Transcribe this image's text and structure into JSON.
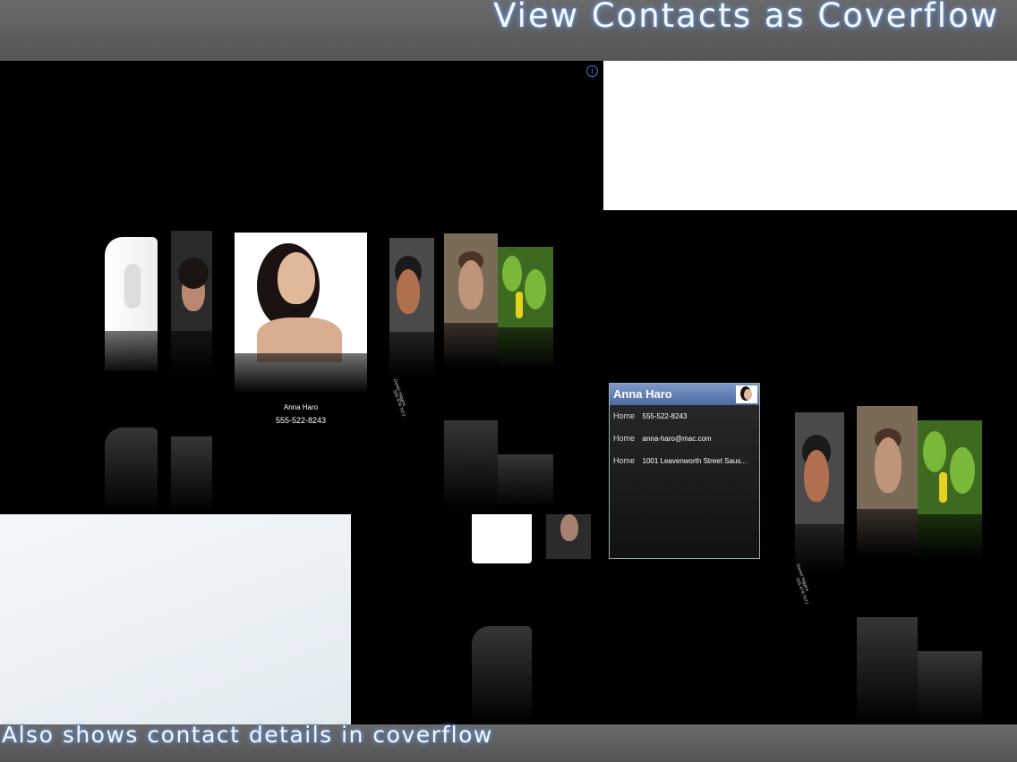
{
  "header": {
    "title": "View Contacts as Coverflow"
  },
  "footer": {
    "caption": "Also shows contact details in coverflow"
  },
  "coverflow": {
    "selected": {
      "name": "Anna Haro",
      "phone": "555-522-8243"
    },
    "side_label_name": "Daniel Higgins",
    "side_label_phone": "555-478-7672"
  },
  "detail_card": {
    "name": "Anna Haro",
    "rows": [
      {
        "label": "Home",
        "value": "555-522-8243"
      },
      {
        "label": "Home",
        "value": "anna-haro@mac.com"
      },
      {
        "label": "Home",
        "value": "1001  Leavenworth Street Saus..."
      }
    ]
  },
  "colors": {
    "band": "#5e5e5e",
    "glow": "#7fa8e0",
    "detail_header": "#6680b4"
  },
  "icons": {
    "info": "info-icon"
  }
}
